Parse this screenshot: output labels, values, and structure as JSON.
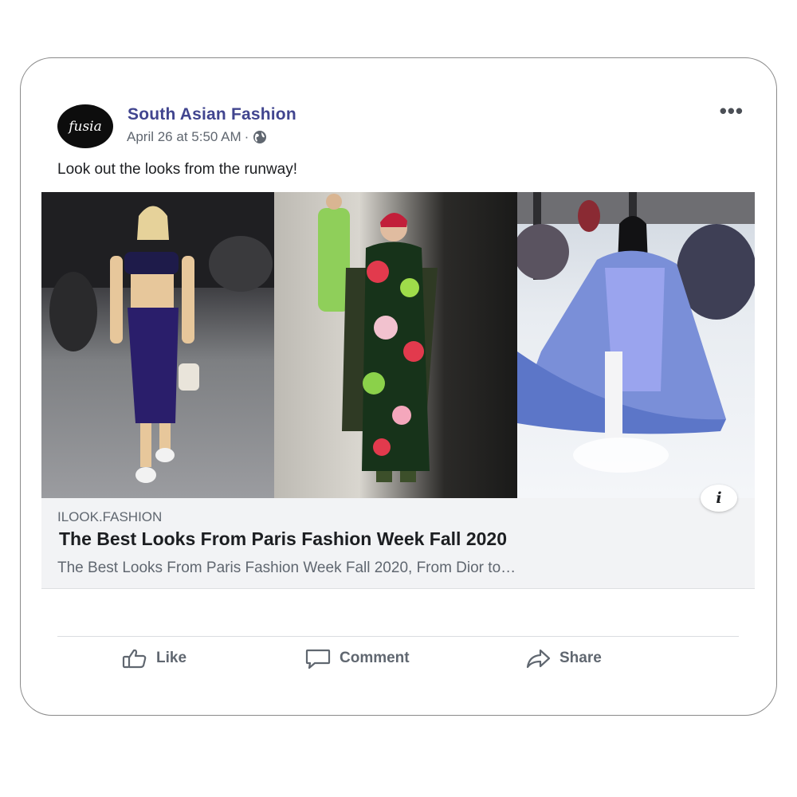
{
  "post": {
    "avatar_text": "fusia",
    "page_name": "South Asian Fashion",
    "timestamp": "April 26 at 5:50 AM",
    "separator": "·",
    "privacy_icon": "globe-icon",
    "more_icon": "•••",
    "caption": "Look out the looks from the runway!"
  },
  "link_preview": {
    "domain": "ILOOK.FASHION",
    "title": "The Best Looks From Paris Fashion Week Fall 2020",
    "description": "The Best Looks From Paris Fashion Week Fall 2020, From Dior to…",
    "info_icon": "i"
  },
  "actions": {
    "like_label": "Like",
    "comment_label": "Comment",
    "share_label": "Share"
  },
  "colors": {
    "page_name": "#41458f",
    "secondary_text": "#606770",
    "link_bg": "#f2f3f5"
  }
}
